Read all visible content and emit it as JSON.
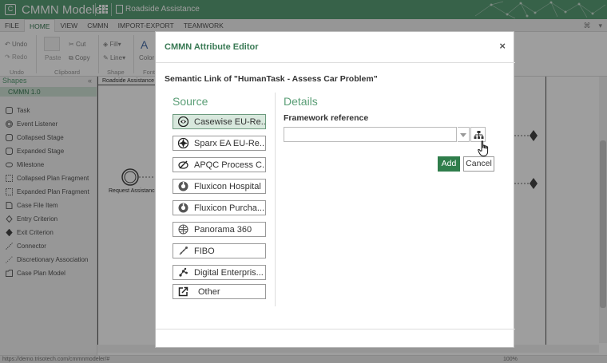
{
  "app": {
    "title": "CMMN Modeler",
    "document_title": "Roadside Assistance"
  },
  "ribbon": {
    "tabs": [
      {
        "label": "FILE"
      },
      {
        "label": "HOME"
      },
      {
        "label": "VIEW"
      },
      {
        "label": "CMMN"
      },
      {
        "label": "IMPORT-EXPORT"
      },
      {
        "label": "TEAMWORK"
      }
    ],
    "undo_label": "Undo",
    "redo_label": "Redo",
    "paste_label": "Paste",
    "cut_label": "Cut",
    "copy_label": "Copy",
    "fill_label": "Fill",
    "line_label": "Line",
    "color_label": "Color",
    "group_undo": "Undo",
    "group_clipboard": "Clipboard",
    "group_shape": "Shape",
    "group_font": "Font"
  },
  "shapes_panel": {
    "title": "Shapes",
    "section": "CMMN 1.0",
    "items": [
      {
        "label": "Task",
        "icon": "task-icon"
      },
      {
        "label": "Event Listener",
        "icon": "event-listener-icon"
      },
      {
        "label": "Collapsed Stage",
        "icon": "collapsed-stage-icon"
      },
      {
        "label": "Expanded Stage",
        "icon": "expanded-stage-icon"
      },
      {
        "label": "Milestone",
        "icon": "milestone-icon"
      },
      {
        "label": "Collapsed Plan Fragment",
        "icon": "collapsed-plan-fragment-icon"
      },
      {
        "label": "Expanded Plan Fragment",
        "icon": "expanded-plan-fragment-icon"
      },
      {
        "label": "Case File Item",
        "icon": "case-file-item-icon"
      },
      {
        "label": "Entry Criterion",
        "icon": "entry-criterion-icon"
      },
      {
        "label": "Exit Criterion",
        "icon": "exit-criterion-icon"
      },
      {
        "label": "Connector",
        "icon": "connector-icon"
      },
      {
        "label": "Discretionary Association",
        "icon": "discretionary-association-icon"
      },
      {
        "label": "Case Plan Model",
        "icon": "case-plan-model-icon"
      }
    ]
  },
  "canvas": {
    "case_plan_label": "Roadside Assistance",
    "event_label": "Request Assistance"
  },
  "status": {
    "url": "https://demo.trisotech.com/cmmnmodeler/#",
    "zoom": "100%"
  },
  "dialog": {
    "title": "CMMN Attribute Editor",
    "close_symbol": "×",
    "subtitle": "Semantic Link of \"HumanTask - Assess Car Problem\"",
    "source_title": "Source",
    "sources": [
      {
        "label": "Casewise EU-Re...",
        "icon": "casewise-icon",
        "selected": true
      },
      {
        "label": "Sparx EA EU-Re...",
        "icon": "sparx-ea-icon",
        "selected": false
      },
      {
        "label": "APQC Process C...",
        "icon": "apqc-icon",
        "selected": false
      },
      {
        "label": "Fluxicon Hospital",
        "icon": "fluxicon-icon",
        "selected": false
      },
      {
        "label": "Fluxicon Purcha...",
        "icon": "fluxicon-icon",
        "selected": false
      },
      {
        "label": "Panorama 360",
        "icon": "panorama-icon",
        "selected": false
      },
      {
        "label": "FIBO",
        "icon": "fibo-icon",
        "selected": false
      },
      {
        "label": "Digital Enterpris...",
        "icon": "digital-enterprise-icon",
        "selected": false
      },
      {
        "label": "Other",
        "icon": "external-link-icon",
        "selected": false
      }
    ],
    "details_title": "Details",
    "framework_label": "Framework reference",
    "framework_value": "",
    "add_label": "Add",
    "cancel_label": "Cancel"
  },
  "colors": {
    "brand": "#5a9e76",
    "primary_button": "#2f7d4b",
    "selected_source": "#d8e8dd"
  }
}
